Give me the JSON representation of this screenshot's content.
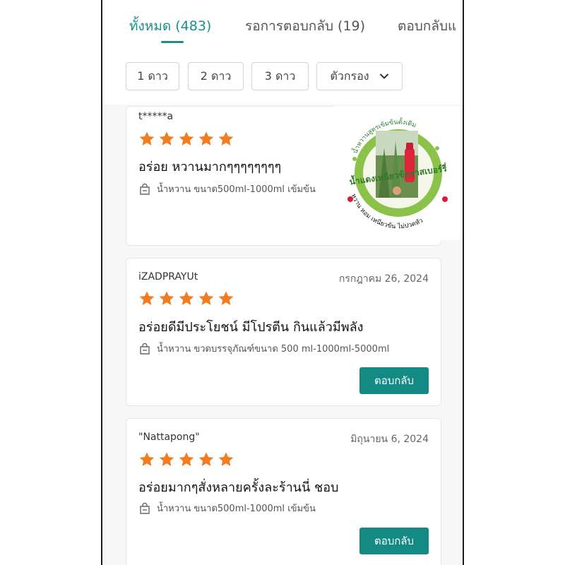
{
  "tabs": [
    {
      "label": "ทั้งหมด (483)"
    },
    {
      "label": "รอการตอบกลับ (19)"
    },
    {
      "label": "ตอบกลับแ"
    }
  ],
  "filters": {
    "chip1": "1 ดาว",
    "chip2": "2 ดาว",
    "chip3": "3 ดาว",
    "filter": "ตัวกรอง"
  },
  "reviews": [
    {
      "user": "t*****a",
      "date": "",
      "stars": 5,
      "text": "อร่อย หวานมากๆๆๆๆๆๆๆๆ",
      "variant": "น้ำหวาน ขนาด500ml-1000ml เข้มข้น"
    },
    {
      "user": "iZADPRAYUt",
      "date": "กรกฎาคม 26, 2024",
      "stars": 5,
      "text": "อร่อยดีมีประโยชน์ มีโปรตีน กินแล้วมีพลัง",
      "variant": "น้ำหวาน ขวดบรรจุภัณฑ์ขนาด 500 ml-1000ml-5000ml",
      "reply": "ตอบกลับ"
    },
    {
      "user": "\"Nattapong\"",
      "date": "มิถุนายน 6, 2024",
      "stars": 5,
      "text": "อร่อยมากๆสั่งหลายครั้งละร้านนี่ ชอบ",
      "variant": "น้ำหวาน ขนาด500ml-1000ml เข้มข้น",
      "reply": "ตอบกลับ"
    }
  ],
  "logo": {
    "top_text": "น้ำหวานสูตรเข้มข้นดั้งเดิม",
    "main_text": "น้ำแดงเหนียวข้นราสเบอร์รี่",
    "bottom_text": "หวาน หอม เหนียวข้น ไม่ปวดหัว"
  },
  "colors": {
    "accent": "#1a8e8a",
    "star": "#f47c20",
    "button": "#148a85",
    "logo_green": "#8bc34a"
  }
}
